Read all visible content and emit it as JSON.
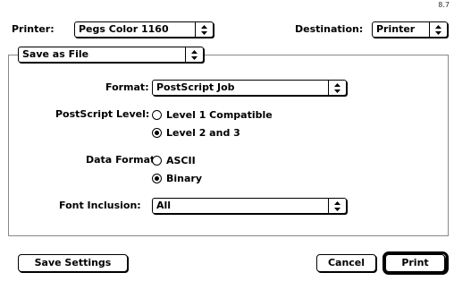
{
  "version": "8.7",
  "header": {
    "printer_label": "Printer:",
    "printer_value": "Pegs Color 1160",
    "destination_label": "Destination:",
    "destination_value": "Printer"
  },
  "section_popup": {
    "value": "Save as File"
  },
  "form": {
    "format_label": "Format:",
    "format_value": "PostScript Job",
    "ps_level_label": "PostScript Level:",
    "ps_level_options": [
      "Level 1 Compatible",
      "Level 2 and 3"
    ],
    "ps_level_selected": 1,
    "data_format_label": "Data Format:",
    "data_format_options": [
      "ASCII",
      "Binary"
    ],
    "data_format_selected": 1,
    "font_inclusion_label": "Font Inclusion:",
    "font_inclusion_value": "All"
  },
  "buttons": {
    "save_settings": "Save Settings",
    "cancel": "Cancel",
    "print": "Print"
  }
}
